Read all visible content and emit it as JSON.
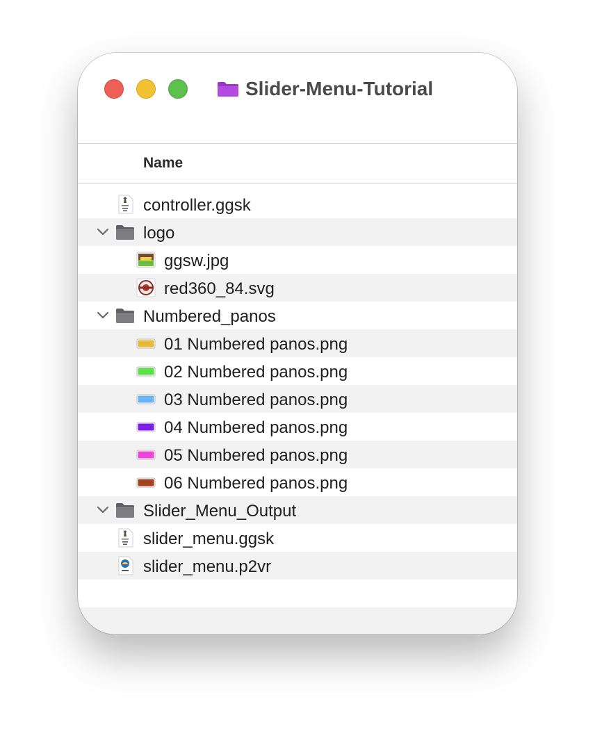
{
  "window": {
    "title": "Slider-Menu-Tutorial",
    "title_icon": "purple-folder-icon"
  },
  "header": {
    "name_label": "Name"
  },
  "colors": {
    "title_folder": "#b44be0",
    "folder": "#7d7d82",
    "swatches": [
      "#e9b938",
      "#5ee04a",
      "#6ab4f6",
      "#7a1ee8",
      "#ee45d9",
      "#a2421f"
    ]
  },
  "items": [
    {
      "name": "controller.ggsk",
      "depth": 0,
      "kind": "ggsk-file",
      "icon": "ggsk-document-icon"
    },
    {
      "name": "logo",
      "depth": 0,
      "kind": "folder",
      "icon": "folder-icon",
      "expanded": true
    },
    {
      "name": "ggsw.jpg",
      "depth": 1,
      "kind": "image",
      "icon": "jpg-thumbnail-icon"
    },
    {
      "name": "red360_84.svg",
      "depth": 1,
      "kind": "image",
      "icon": "svg-thumbnail-icon"
    },
    {
      "name": "Numbered_panos",
      "depth": 0,
      "kind": "folder",
      "icon": "folder-icon",
      "expanded": true
    },
    {
      "name": "01 Numbered panos.png",
      "depth": 1,
      "kind": "png",
      "icon": "png-swatch-icon",
      "swatch": "#e9b938"
    },
    {
      "name": "02 Numbered panos.png",
      "depth": 1,
      "kind": "png",
      "icon": "png-swatch-icon",
      "swatch": "#5ee04a"
    },
    {
      "name": "03 Numbered panos.png",
      "depth": 1,
      "kind": "png",
      "icon": "png-swatch-icon",
      "swatch": "#6ab4f6"
    },
    {
      "name": "04 Numbered panos.png",
      "depth": 1,
      "kind": "png",
      "icon": "png-swatch-icon",
      "swatch": "#7a1ee8"
    },
    {
      "name": "05 Numbered panos.png",
      "depth": 1,
      "kind": "png",
      "icon": "png-swatch-icon",
      "swatch": "#ee45d9"
    },
    {
      "name": "06 Numbered panos.png",
      "depth": 1,
      "kind": "png",
      "icon": "png-swatch-icon",
      "swatch": "#a2421f"
    },
    {
      "name": "Slider_Menu_Output",
      "depth": 0,
      "kind": "folder",
      "icon": "folder-icon",
      "expanded": true
    },
    {
      "name": "slider_menu.ggsk",
      "depth": 0,
      "kind": "ggsk-file",
      "icon": "ggsk-document-icon"
    },
    {
      "name": "slider_menu.p2vr",
      "depth": 0,
      "kind": "p2vr-file",
      "icon": "p2vr-document-icon"
    }
  ]
}
